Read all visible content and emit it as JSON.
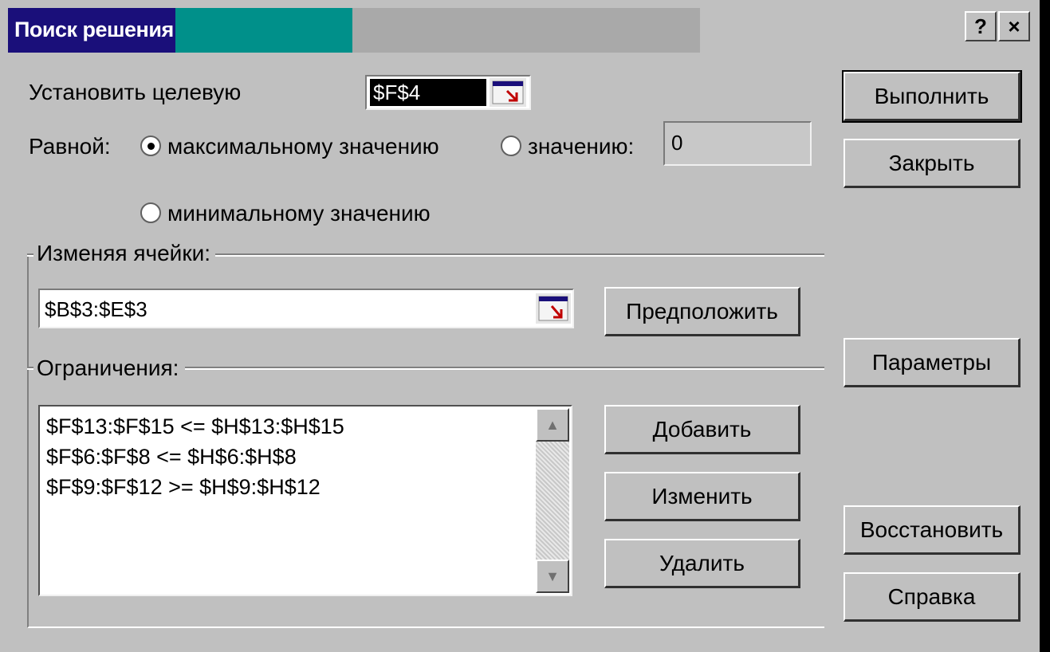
{
  "window": {
    "title": "Поиск решения",
    "help_btn": "?",
    "close_btn": "×"
  },
  "target": {
    "label": "Установить целевую",
    "value": "$F$4"
  },
  "equal_to": {
    "label": "Равной:",
    "option_max": "максимальному значению",
    "option_value": "значению:",
    "option_min": "минимальному значению",
    "value_field": "0",
    "selected": "max"
  },
  "changing_cells": {
    "label": "Изменяя ячейки:",
    "value": "$B$3:$E$3",
    "guess_button": "Предположить"
  },
  "constraints": {
    "label": "Ограничения:",
    "items": [
      "$F$13:$F$15 <= $H$13:$H$15",
      "$F$6:$F$8 <= $H$6:$H$8",
      "$F$9:$F$12 >= $H$9:$H$12"
    ],
    "add_button": "Добавить",
    "change_button": "Изменить",
    "delete_button": "Удалить"
  },
  "side_buttons": {
    "solve": "Выполнить",
    "close": "Закрыть",
    "options": "Параметры",
    "reset": "Восстановить",
    "help": "Справка"
  }
}
